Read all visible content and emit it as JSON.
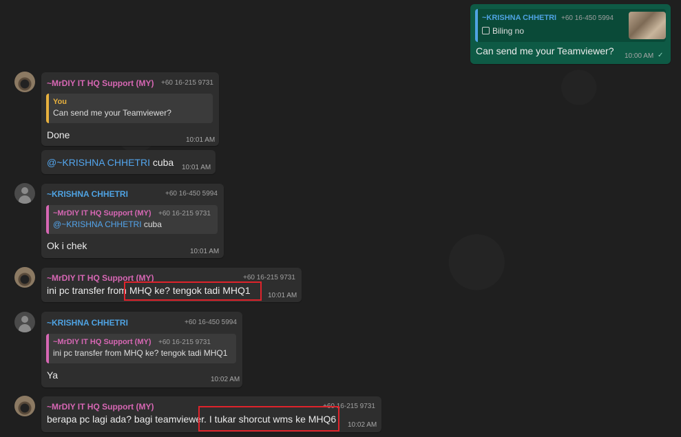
{
  "colors": {
    "mrdiy_name": "#d767b4",
    "krishna_name": "#4fa3e3",
    "you_name": "#e8b13e",
    "outgoing_bubble": "#0e5a45",
    "incoming_bubble": "#2e2e2e",
    "highlight_box": "#e0232b"
  },
  "messages": [
    {
      "id": "m0",
      "direction": "outgoing",
      "quote": {
        "name": "~KRISHNA CHHETRI",
        "phone": "+60 16-450 5994",
        "text": "Biling no",
        "icon": "image-icon"
      },
      "text": "Can send me your Teamviewer?",
      "time": "10:00 AM",
      "status": "✓"
    },
    {
      "id": "m1",
      "sender": "~MrDIY IT HQ Support (MY)",
      "phone": "+60 16-215 9731",
      "quote": {
        "name": "You",
        "text": "Can send me your Teamviewer?"
      },
      "text": "Done",
      "time": "10:01 AM"
    },
    {
      "id": "m2",
      "mention": "@~KRISHNA CHHETRI",
      "text": " cuba",
      "time": "10:01 AM"
    },
    {
      "id": "m3",
      "sender": "~KRISHNA CHHETRI",
      "phone": "+60 16-450 5994",
      "quote": {
        "name": "~MrDIY IT HQ Support (MY)",
        "phone": "+60 16-215 9731",
        "mention": "@~KRISHNA CHHETRI",
        "text": " cuba"
      },
      "text": "Ok i chek",
      "time": "10:01 AM"
    },
    {
      "id": "m4",
      "sender": "~MrDIY IT HQ Support (MY)",
      "phone": "+60 16-215 9731",
      "text": "ini pc transfer from MHQ ke? tengok tadi MHQ1",
      "time": "10:01 AM"
    },
    {
      "id": "m5",
      "sender": "~KRISHNA CHHETRI",
      "phone": "+60 16-450 5994",
      "quote": {
        "name": "~MrDIY IT HQ Support (MY)",
        "phone": "+60 16-215 9731",
        "text": "ini pc transfer from MHQ ke? tengok tadi MHQ1"
      },
      "text": "Ya",
      "time": "10:02 AM"
    },
    {
      "id": "m6",
      "sender": "~MrDIY IT HQ Support (MY)",
      "phone": "+60 16-215 9731",
      "text": "berapa pc lagi ada? bagi teamviewer. I tukar shorcut wms ke MHQ6",
      "time": "10:02 AM"
    }
  ]
}
